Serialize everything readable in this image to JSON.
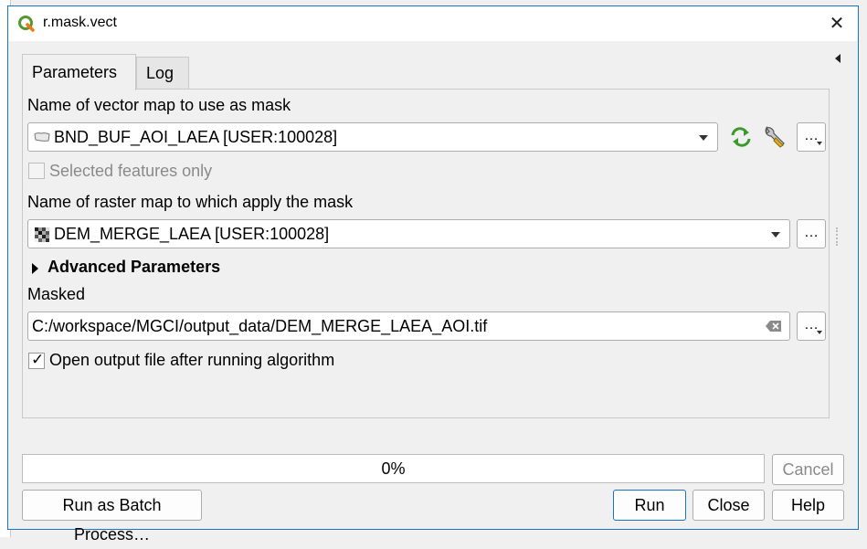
{
  "window": {
    "title": "r.mask.vect",
    "close_glyph": "✕"
  },
  "tabs": [
    {
      "label": "Parameters",
      "active": true
    },
    {
      "label": "Log",
      "active": false
    }
  ],
  "params": {
    "vector_label": "Name of vector map to use as mask",
    "vector_value": "BND_BUF_AOI_LAEA [USER:100028]",
    "selected_only_label": "Selected features only",
    "raster_label": "Name of raster map to which apply the mask",
    "raster_value": "DEM_MERGE_LAEA [USER:100028]",
    "advanced_label": "Advanced Parameters",
    "masked_label": "Masked",
    "masked_value": "C:/workspace/MGCI/output_data/DEM_MERGE_LAEA_AOI.tif",
    "open_output_label": "Open output file after running algorithm",
    "open_output_checked": true,
    "dots_label": "…"
  },
  "progress": {
    "text": "0%",
    "value": 0
  },
  "buttons": {
    "cancel": "Cancel",
    "batch": "Run as Batch Process…",
    "run": "Run",
    "close": "Close",
    "help": "Help"
  },
  "icons": {
    "title": "qgis-logo-icon",
    "vector_layer": "polygon-layer-icon",
    "raster_layer": "raster-layer-icon",
    "iterate": "iterate-icon",
    "wrench": "wrench-icon",
    "clear": "clear-text-icon",
    "check": "✓"
  },
  "colors": {
    "accent": "#1a73c9",
    "qgis_green": "#589632",
    "qgis_yellow": "#ee7913"
  }
}
